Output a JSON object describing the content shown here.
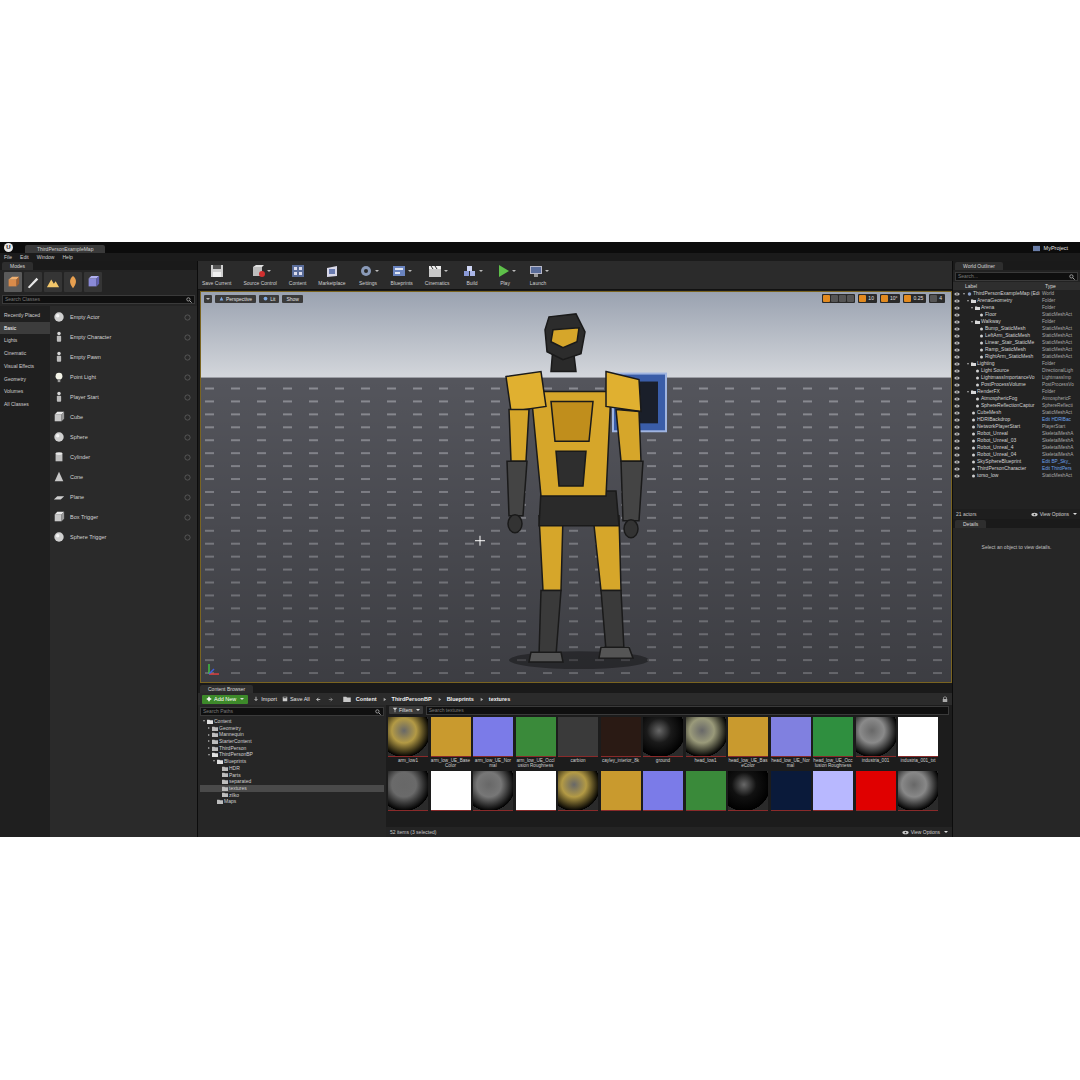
{
  "window": {
    "logo": "U",
    "tab_title": "ThirdPersonExampleMap",
    "project": "MyProject"
  },
  "menu": [
    "File",
    "Edit",
    "Window",
    "Help"
  ],
  "modes": {
    "tab": "Modes",
    "search_placeholder": "Search Classes",
    "tools": [
      {
        "kind": "place",
        "selected": true
      },
      {
        "kind": "paint",
        "selected": false
      },
      {
        "kind": "landscape",
        "selected": false
      },
      {
        "kind": "foliage",
        "selected": false
      },
      {
        "kind": "geometry",
        "selected": false
      }
    ],
    "categories": [
      {
        "label": "Recently Placed",
        "selected": false
      },
      {
        "label": "Basic",
        "selected": true
      },
      {
        "label": "Lights",
        "selected": false
      },
      {
        "label": "Cinematic",
        "selected": false
      },
      {
        "label": "Visual Effects",
        "selected": false
      },
      {
        "label": "Geometry",
        "selected": false
      },
      {
        "label": "Volumes",
        "selected": false
      },
      {
        "label": "All Classes",
        "selected": false
      }
    ],
    "items": [
      {
        "label": "Empty Actor",
        "kind": "sphere"
      },
      {
        "label": "Empty Character",
        "kind": "figure"
      },
      {
        "label": "Empty Pawn",
        "kind": "figure"
      },
      {
        "label": "Point Light",
        "kind": "light"
      },
      {
        "label": "Player Start",
        "kind": "figure"
      },
      {
        "label": "Cube",
        "kind": "cube"
      },
      {
        "label": "Sphere",
        "kind": "sphere"
      },
      {
        "label": "Cylinder",
        "kind": "cylinder"
      },
      {
        "label": "Cone",
        "kind": "cone"
      },
      {
        "label": "Plane",
        "kind": "plane"
      },
      {
        "label": "Box Trigger",
        "kind": "cube"
      },
      {
        "label": "Sphere Trigger",
        "kind": "sphere"
      }
    ]
  },
  "toolbar": [
    {
      "label": "Save Current",
      "kind": "save",
      "dropdown": false
    },
    {
      "label": "Source Control",
      "kind": "source",
      "dropdown": true
    },
    {
      "label": "Content",
      "kind": "content",
      "dropdown": false
    },
    {
      "label": "Marketplace",
      "kind": "market",
      "dropdown": false
    },
    {
      "label": "Settings",
      "kind": "settings",
      "dropdown": true
    },
    {
      "label": "Blueprints",
      "kind": "blueprints",
      "dropdown": true
    },
    {
      "label": "Cinematics",
      "kind": "cinematics",
      "dropdown": true
    },
    {
      "label": "Build",
      "kind": "build",
      "dropdown": true
    },
    {
      "label": "Play",
      "kind": "play",
      "dropdown": true
    },
    {
      "label": "Launch",
      "kind": "launch",
      "dropdown": true
    }
  ],
  "viewport": {
    "view": "Perspective",
    "lighting": "Lit",
    "show": "Show",
    "snaps": [
      {
        "value": "10",
        "active": true
      },
      {
        "value": "10°",
        "active": true
      },
      {
        "value": "0.25",
        "active": true
      },
      {
        "value": "4",
        "active": false
      }
    ]
  },
  "outliner": {
    "tab": "World Outliner",
    "search_placeholder": "Search...",
    "columns": [
      "Label",
      "Type"
    ],
    "rows": [
      {
        "label": "ThirdPersonExampleMap (Edi",
        "type": "World",
        "depth": 0,
        "kind": "world",
        "expanded": true,
        "link": false
      },
      {
        "label": "ArenaGeometry",
        "type": "Folder",
        "depth": 1,
        "kind": "folder",
        "expanded": true,
        "link": false
      },
      {
        "label": "Arena",
        "type": "Folder",
        "depth": 2,
        "kind": "folder",
        "expanded": true,
        "link": false
      },
      {
        "label": "Floor",
        "type": "StaticMeshAct",
        "depth": 3,
        "kind": "actor",
        "expanded": false,
        "link": false
      },
      {
        "label": "Walkway",
        "type": "Folder",
        "depth": 2,
        "kind": "folder",
        "expanded": true,
        "link": false
      },
      {
        "label": "Bump_StaticMesh",
        "type": "StaticMeshAct",
        "depth": 3,
        "kind": "actor",
        "expanded": false,
        "link": false
      },
      {
        "label": "LeftArm_StaticMesh",
        "type": "StaticMeshAct",
        "depth": 3,
        "kind": "actor",
        "expanded": false,
        "link": false
      },
      {
        "label": "Linear_Stair_StaticMe",
        "type": "StaticMeshAct",
        "depth": 3,
        "kind": "actor",
        "expanded": false,
        "link": false
      },
      {
        "label": "Ramp_StaticMesh",
        "type": "StaticMeshAct",
        "depth": 3,
        "kind": "actor",
        "expanded": false,
        "link": false
      },
      {
        "label": "RightArm_StaticMesh",
        "type": "StaticMeshAct",
        "depth": 3,
        "kind": "actor",
        "expanded": false,
        "link": false
      },
      {
        "label": "Lighting",
        "type": "Folder",
        "depth": 1,
        "kind": "folder",
        "expanded": true,
        "link": false
      },
      {
        "label": "Light Source",
        "type": "DirectionalLigh",
        "depth": 2,
        "kind": "actor",
        "expanded": false,
        "link": false
      },
      {
        "label": "LightmassImportanceVo",
        "type": "LightmassImp",
        "depth": 2,
        "kind": "actor",
        "expanded": false,
        "link": false
      },
      {
        "label": "PostProcessVolume",
        "type": "PostProcessVo",
        "depth": 2,
        "kind": "actor",
        "expanded": false,
        "link": false
      },
      {
        "label": "RenderFX",
        "type": "Folder",
        "depth": 1,
        "kind": "folder",
        "expanded": true,
        "link": false
      },
      {
        "label": "AtmosphericFog",
        "type": "AtmosphericF",
        "depth": 2,
        "kind": "actor",
        "expanded": false,
        "link": false
      },
      {
        "label": "SphereReflectionCaptur",
        "type": "SphereReflecti",
        "depth": 2,
        "kind": "actor",
        "expanded": false,
        "link": false
      },
      {
        "label": "CubeMesh",
        "type": "StaticMeshAct",
        "depth": 1,
        "kind": "actor",
        "expanded": false,
        "link": false
      },
      {
        "label": "HDRIBackdrop",
        "type": "Edit HDRIBac",
        "depth": 1,
        "kind": "actor",
        "expanded": false,
        "link": true
      },
      {
        "label": "NetworkPlayerStart",
        "type": "PlayerStart",
        "depth": 1,
        "kind": "actor",
        "expanded": false,
        "link": false
      },
      {
        "label": "Robot_Unreal",
        "type": "SkeletalMeshA",
        "depth": 1,
        "kind": "actor",
        "expanded": false,
        "link": false
      },
      {
        "label": "Robot_Unreal_03",
        "type": "SkeletalMeshA",
        "depth": 1,
        "kind": "actor",
        "expanded": false,
        "link": false
      },
      {
        "label": "Robot_Unreal_4",
        "type": "SkeletalMeshA",
        "depth": 1,
        "kind": "actor",
        "expanded": false,
        "link": false
      },
      {
        "label": "Robot_Unreal_04",
        "type": "SkeletalMeshA",
        "depth": 1,
        "kind": "actor",
        "expanded": false,
        "link": false
      },
      {
        "label": "SkySphereBlueprint",
        "type": "Edit BP_Sky_",
        "depth": 1,
        "kind": "actor",
        "expanded": false,
        "link": true
      },
      {
        "label": "ThirdPersonCharacter",
        "type": "Edit ThirdPers",
        "depth": 1,
        "kind": "actor",
        "expanded": false,
        "link": true
      },
      {
        "label": "torso_low",
        "type": "StaticMeshAct",
        "depth": 1,
        "kind": "actor",
        "expanded": false,
        "link": false
      }
    ],
    "count": "21 actors",
    "view_options": "View Options"
  },
  "details": {
    "tab": "Details",
    "empty_message": "Select an object to view details."
  },
  "content_browser": {
    "tab": "Content Browser",
    "add_new": "Add New",
    "import": "Import",
    "save_all": "Save All",
    "path": [
      "Content",
      "ThirdPersonBP",
      "Blueprints",
      "textures"
    ],
    "search_paths_placeholder": "Search Paths",
    "folders": [
      {
        "label": "Content",
        "depth": 0,
        "has_children": true,
        "expanded": true,
        "selected": false
      },
      {
        "label": "Geometry",
        "depth": 1,
        "has_children": true,
        "expanded": false,
        "selected": false
      },
      {
        "label": "Mannequin",
        "depth": 1,
        "has_children": true,
        "expanded": false,
        "selected": false
      },
      {
        "label": "StarterContent",
        "depth": 1,
        "has_children": true,
        "expanded": false,
        "selected": false
      },
      {
        "label": "ThirdPerson",
        "depth": 1,
        "has_children": true,
        "expanded": false,
        "selected": false
      },
      {
        "label": "ThirdPersonBP",
        "depth": 1,
        "has_children": true,
        "expanded": true,
        "selected": false
      },
      {
        "label": "Blueprints",
        "depth": 2,
        "has_children": true,
        "expanded": true,
        "selected": false
      },
      {
        "label": "HDR",
        "depth": 3,
        "has_children": false,
        "expanded": false,
        "selected": false
      },
      {
        "label": "Parts",
        "depth": 3,
        "has_children": false,
        "expanded": false,
        "selected": false
      },
      {
        "label": "separated",
        "depth": 3,
        "has_children": false,
        "expanded": false,
        "selected": false
      },
      {
        "label": "textures",
        "depth": 3,
        "has_children": false,
        "expanded": false,
        "selected": true
      },
      {
        "label": "zilko",
        "depth": 3,
        "has_children": false,
        "expanded": false,
        "selected": false
      },
      {
        "label": "Maps",
        "depth": 2,
        "has_children": false,
        "expanded": false,
        "selected": false
      }
    ],
    "filters": "Filters",
    "search_placeholder": "Search textures",
    "assets": [
      {
        "label": "arm_low1",
        "kind": "sphere",
        "color": "#b39a45"
      },
      {
        "label": "arm_low_UE_Base Color",
        "kind": "flat",
        "color": "#c99a2e"
      },
      {
        "label": "arm_low_UE_Normal",
        "kind": "flat",
        "color": "#7b7be8"
      },
      {
        "label": "arm_low_UE_Occlusion Roughness",
        "kind": "flat",
        "color": "#3a8a3a"
      },
      {
        "label": "carbion",
        "kind": "flat",
        "color": "#3a3a3a"
      },
      {
        "label": "cayley_interior_8k",
        "kind": "flat",
        "color": "#2a1a14"
      },
      {
        "label": "ground",
        "kind": "sphere",
        "color": "#1a1a1a"
      },
      {
        "label": "head_low1",
        "kind": "sphere",
        "color": "#9a9a7a"
      },
      {
        "label": "head_low_UE_BaseColor",
        "kind": "flat",
        "color": "#c99a2e"
      },
      {
        "label": "head_low_UE_Normal",
        "kind": "flat",
        "color": "#8080e0"
      },
      {
        "label": "head_low_UE_Occlusion Roughness",
        "kind": "flat",
        "color": "#2f8f3f"
      },
      {
        "label": "industria_001",
        "kind": "sphere",
        "color": "#8a8a8a"
      },
      {
        "label": "industria_001_txt",
        "kind": "flat",
        "color": "#ffffff"
      },
      {
        "kind": "sphere",
        "color": "#6a6a6a"
      },
      {
        "kind": "flat",
        "color": "#ffffff"
      },
      {
        "kind": "sphere",
        "color": "#777777"
      },
      {
        "kind": "flat",
        "color": "#ffffff"
      },
      {
        "kind": "sphere",
        "color": "#b39a45"
      },
      {
        "kind": "flat",
        "color": "#c99a2e"
      },
      {
        "kind": "flat",
        "color": "#7b7be8"
      },
      {
        "kind": "flat",
        "color": "#3a8a3a"
      },
      {
        "kind": "sphere",
        "color": "#111111"
      },
      {
        "kind": "flat",
        "color": "#0a1a3a"
      },
      {
        "kind": "flat",
        "color": "#b8b8ff"
      },
      {
        "kind": "flat",
        "color": "#e00000"
      },
      {
        "kind": "sphere",
        "color": "#888888"
      }
    ],
    "status": "52 items (3 selected)",
    "view_options": "View Options"
  }
}
